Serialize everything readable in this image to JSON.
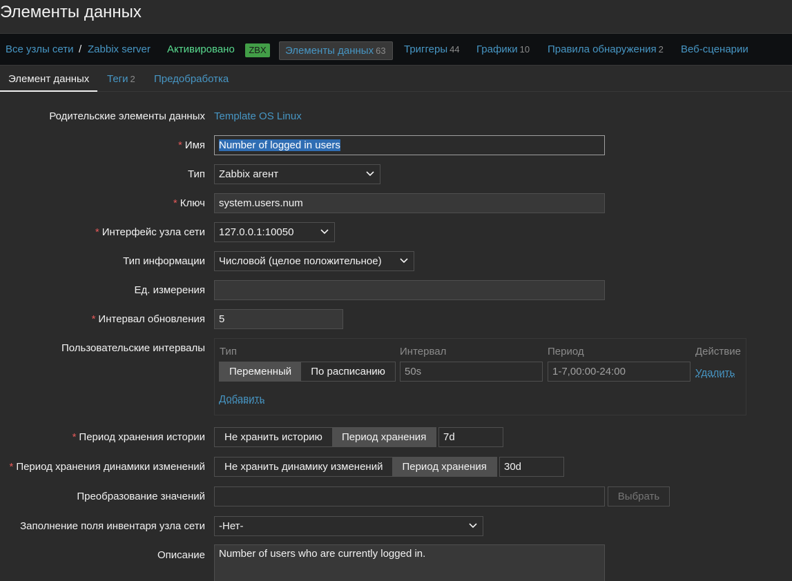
{
  "page": {
    "title": "Элементы данных"
  },
  "hostbar": {
    "all_hosts": "Все узлы сети",
    "separator": "/",
    "host": "Zabbix server",
    "status": "Активировано",
    "zbx": "ZBX",
    "items": {
      "label": "Элементы данных",
      "count": "63"
    },
    "triggers": {
      "label": "Триггеры",
      "count": "44"
    },
    "graphs": {
      "label": "Графики",
      "count": "10"
    },
    "discovery": {
      "label": "Правила обнаружения",
      "count": "2"
    },
    "web": {
      "label": "Веб-сценарии"
    }
  },
  "tabs": {
    "item": "Элемент данных",
    "tags": {
      "label": "Теги",
      "count": "2"
    },
    "preprocessing": "Предобработка"
  },
  "form": {
    "parent": {
      "label": "Родительские элементы данных",
      "value": "Template OS Linux"
    },
    "name": {
      "label": "Имя",
      "value": "Number of logged in users"
    },
    "type": {
      "label": "Тип",
      "value": "Zabbix агент"
    },
    "key": {
      "label": "Ключ",
      "value": "system.users.num"
    },
    "interface": {
      "label": "Интерфейс узла сети",
      "value": "127.0.0.1:10050"
    },
    "info_type": {
      "label": "Тип информации",
      "value": "Числовой (целое положительное)"
    },
    "units": {
      "label": "Ед. измерения",
      "value": ""
    },
    "update_interval": {
      "label": "Интервал обновления",
      "value": "5"
    },
    "custom_intervals": {
      "label": "Пользовательские интервалы",
      "headers": {
        "type": "Тип",
        "interval": "Интервал",
        "period": "Период",
        "action": "Действие"
      },
      "row": {
        "flexible": "Переменный",
        "scheduling": "По расписанию",
        "interval": "50s",
        "period": "1-7,00:00-24:00",
        "remove": "Удалить"
      },
      "add": "Добавить"
    },
    "history": {
      "label": "Период хранения истории",
      "opt_none": "Не хранить историю",
      "opt_period": "Период хранения",
      "value": "7d"
    },
    "trends": {
      "label": "Период хранения динамики изменений",
      "opt_none": "Не хранить динамику изменений",
      "opt_period": "Период хранения",
      "value": "30d"
    },
    "valuemap": {
      "label": "Преобразование значений",
      "value": "",
      "select": "Выбрать"
    },
    "inventory": {
      "label": "Заполнение поля инвентаря узла сети",
      "value": "-Нет-"
    },
    "description": {
      "label": "Описание",
      "value": "Number of users who are currently logged in."
    }
  },
  "colors": {
    "link": "#4796c4",
    "status": "#59db8f",
    "zbx_badge": "#429e47",
    "required": "#e45959",
    "selection": "#2f6db3"
  },
  "icons": {
    "dropdown": "chevron-down-icon"
  }
}
